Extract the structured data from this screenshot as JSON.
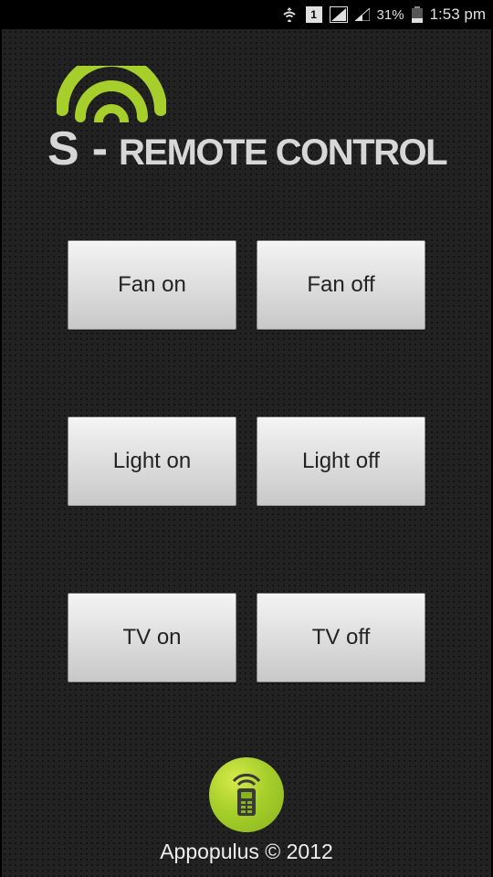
{
  "statusBar": {
    "simLabel": "1",
    "batteryPercent": "31%",
    "time": "1:53 pm"
  },
  "logo": {
    "letter": "S",
    "dash": "-",
    "rest": "REMOTE CONTROL"
  },
  "buttons": {
    "fanOn": "Fan on",
    "fanOff": "Fan off",
    "lightOn": "Light on",
    "lightOff": "Light off",
    "tvOn": "TV on",
    "tvOff": "TV off"
  },
  "footer": {
    "credit": "Appopulus © 2012"
  }
}
